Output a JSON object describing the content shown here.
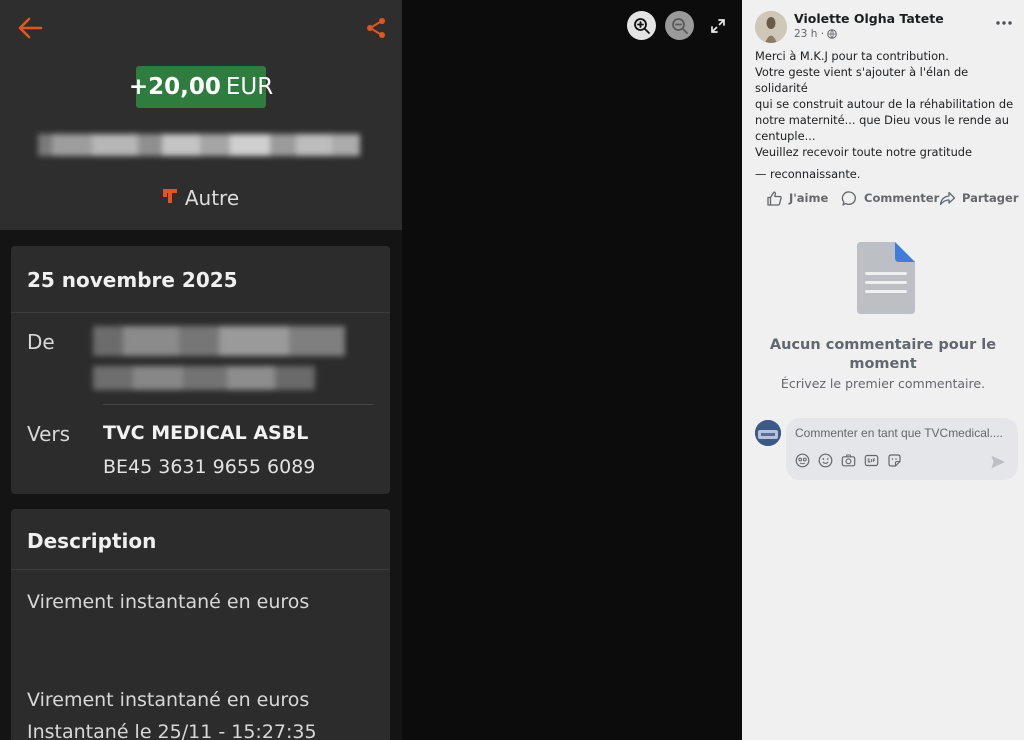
{
  "bank": {
    "amount": "+20,00",
    "currency": "EUR",
    "category": "Autre",
    "date_heading": "25 novembre 2025",
    "from_label": "De",
    "to_label": "Vers",
    "recipient_name": "TVC MEDICAL ASBL",
    "recipient_iban": "BE45 3631 9655 6089",
    "description_heading": "Description",
    "description_lines": [
      "Virement instantané en euros",
      "Virement instantané en euros",
      "Instantané le 25/11 - 15:27:35"
    ],
    "accent_color": "#e3561b",
    "amount_badge_color": "#2e7d3e"
  },
  "viewer": {
    "icons": [
      "zoom-in-icon",
      "zoom-out-icon",
      "fullscreen-icon"
    ]
  },
  "post": {
    "author": "Violette Olgha Tatete",
    "time": "23 h ·",
    "body_lines": [
      "Merci à M.K.J pour ta contribution.",
      "Votre geste vient s'ajouter à l'élan de solidarité",
      "qui se construit autour de la réhabilitation de",
      "notre maternité... que Dieu vous le rende au",
      "centuple...",
      "Veuillez recevoir toute notre gratitude"
    ],
    "signature": "— reconnaissante.",
    "actions": {
      "like": "J'aime",
      "comment": "Commenter",
      "share": "Partager"
    },
    "empty_title": "Aucun commentaire pour le moment",
    "empty_subtitle": "Écrivez le premier commentaire.",
    "comment_placeholder": "Commenter en tant que TVCmedical....",
    "comment_tools": [
      "avatar-sticker-icon",
      "emoji-icon",
      "camera-icon",
      "gif-icon",
      "sticker-icon"
    ]
  }
}
